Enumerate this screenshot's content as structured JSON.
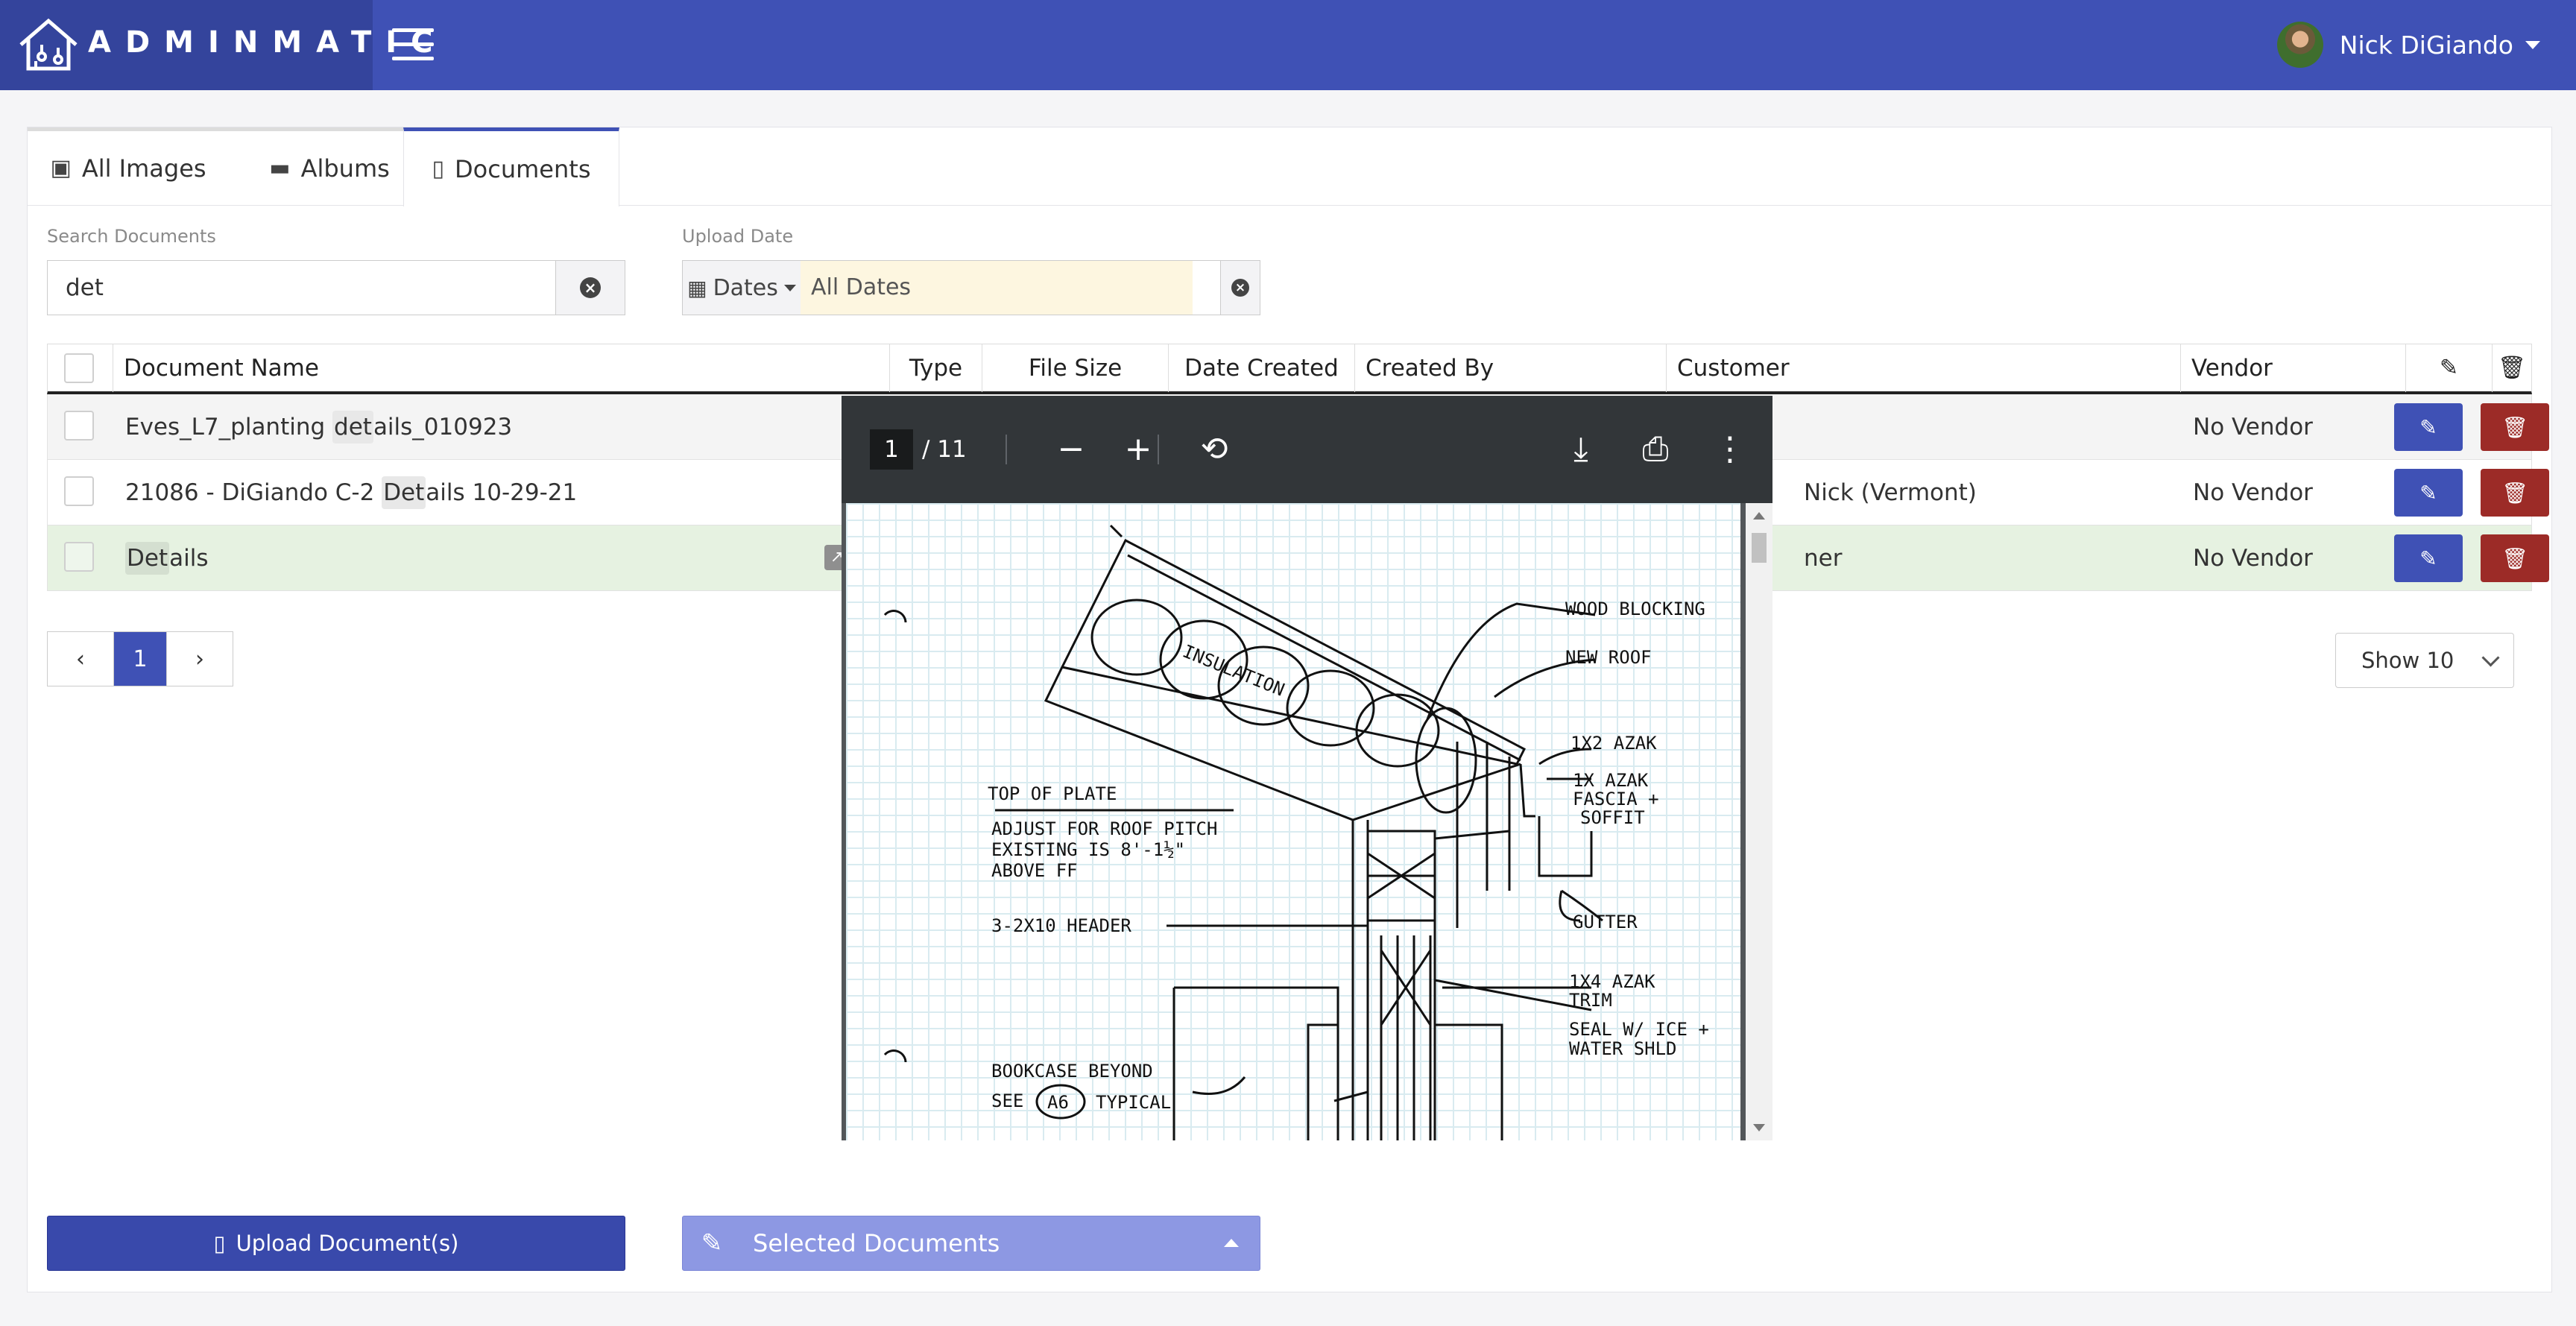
{
  "brand": {
    "name": "ADMINMATIC"
  },
  "user": {
    "name": "Nick DiGiando"
  },
  "tabs": [
    {
      "label": "All Images",
      "icon": "image-icon"
    },
    {
      "label": "Albums",
      "icon": "folder-icon"
    },
    {
      "label": "Documents",
      "icon": "file-icon",
      "active": true
    }
  ],
  "search": {
    "label": "Search Documents",
    "value": "det",
    "placeholder": ""
  },
  "upload_date": {
    "label": "Upload Date",
    "button_label": "Dates",
    "value": "All Dates"
  },
  "table": {
    "headers": {
      "name": "Document Name",
      "type": "Type",
      "size": "File Size",
      "created": "Date Created",
      "created_by": "Created By",
      "customer": "Customer",
      "vendor": "Vendor"
    },
    "rows": [
      {
        "name_pre": "Eves_L7_planting ",
        "name_hl": "det",
        "name_post": "ails_010923",
        "customer": "",
        "vendor": "No Vendor"
      },
      {
        "name_pre": "21086 - DiGiando C-2 ",
        "name_hl": "Det",
        "name_post": "ails 10-29-21",
        "customer": "Nick (Vermont)",
        "vendor": "No Vendor"
      },
      {
        "name_pre": "",
        "name_hl": "Det",
        "name_post": "ails",
        "customer": "ner",
        "vendor": "No Vendor"
      }
    ]
  },
  "pagination": {
    "current": "1",
    "show_label": "Show 10"
  },
  "buttons": {
    "upload": "Upload Document(s)",
    "selected": "Selected Documents"
  },
  "pdf_viewer": {
    "page_current": "1",
    "page_total": "/ 11",
    "sketch_labels": {
      "wood_blocking": "WOOD BLOCKING",
      "new_roof": "NEW ROOF",
      "insulation": "INSULATION",
      "azak_1x2": "1X2 AZAK",
      "azak_fascia_1": "1X AZAK",
      "azak_fascia_2": "FASCIA +",
      "azak_fascia_3": "SOFFIT",
      "top_of_plate": "TOP OF PLATE",
      "adjust_1": "ADJUST FOR ROOF PITCH",
      "adjust_2": "EXISTING IS 8'-1½\"",
      "adjust_3": "ABOVE FF",
      "gutter": "GUTTER",
      "header": "3-2X10 HEADER",
      "trim_1": "1X4 AZAK",
      "trim_2": "TRIM",
      "seal_1": "SEAL W/ ICE +",
      "seal_2": "WATER SHLD",
      "bookcase_1": "BOOKCASE BEYOND",
      "bookcase_2": "SEE",
      "bookcase_ref": "A6",
      "bookcase_3": "TYPICAL"
    }
  }
}
